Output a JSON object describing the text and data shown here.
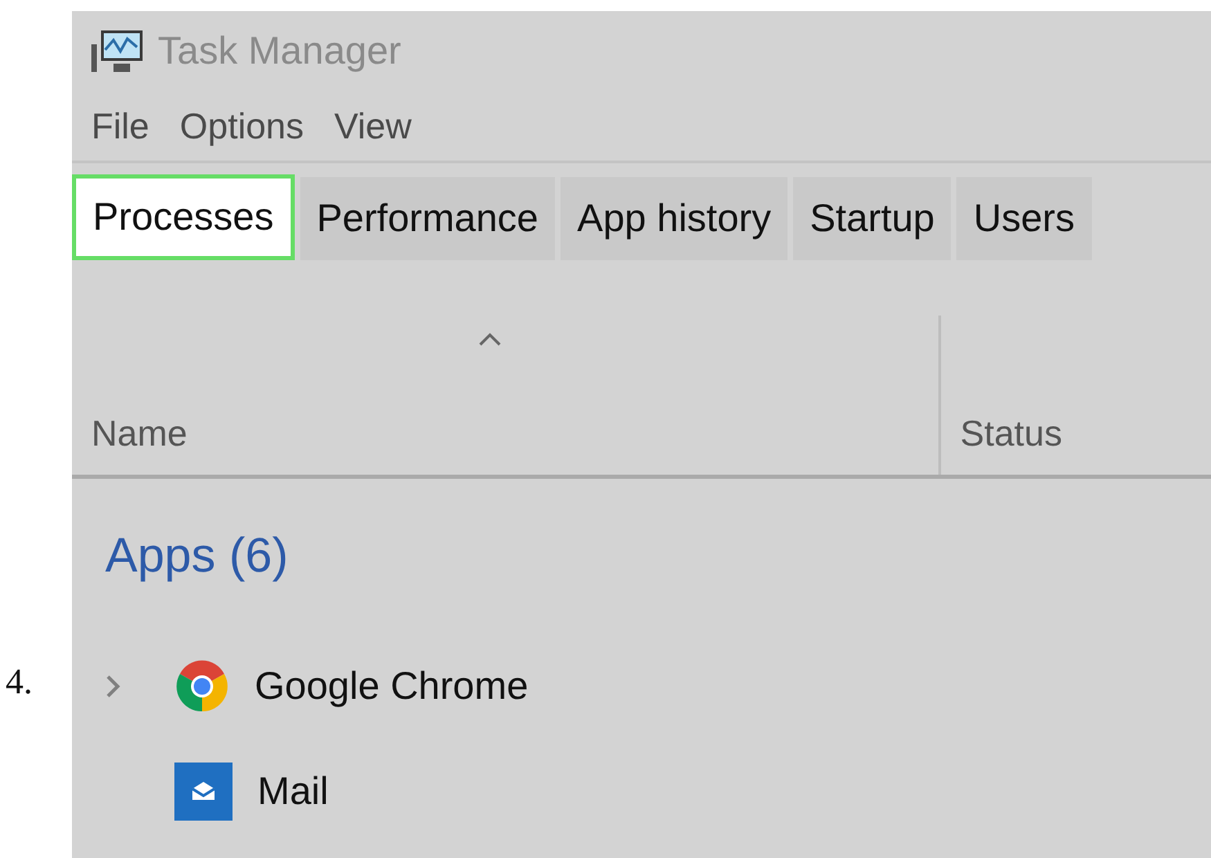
{
  "step_number": "4.",
  "window": {
    "title": "Task Manager"
  },
  "menu": [
    "File",
    "Options",
    "View"
  ],
  "tabs": [
    {
      "label": "Processes",
      "selected": true
    },
    {
      "label": "Performance",
      "selected": false
    },
    {
      "label": "App history",
      "selected": false
    },
    {
      "label": "Startup",
      "selected": false
    },
    {
      "label": "Users",
      "selected": false
    }
  ],
  "table": {
    "columns": [
      {
        "label": "Name",
        "sorted": true
      },
      {
        "label": "Status",
        "sorted": false
      }
    ],
    "groups": [
      {
        "title": "Apps (6)",
        "items": [
          {
            "name": "Google Chrome",
            "kind": "chrome",
            "expandable": true
          },
          {
            "name": "Mail",
            "kind": "mail",
            "expandable": false
          }
        ]
      }
    ]
  }
}
